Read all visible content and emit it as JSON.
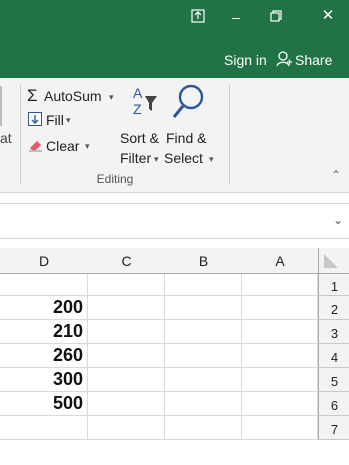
{
  "titlebar": {
    "ribbon_display_icon": "ribbon-display-options-icon",
    "minimize_glyph": "–",
    "restore_glyph": "🗗",
    "close_glyph": "✕",
    "sign_in": "Sign in",
    "share": "Share",
    "share_icon": "person-icon",
    "accent_color": "#217346"
  },
  "ribbon": {
    "cut_fragment": "at",
    "autosum": "AutoSum",
    "fill": "Fill",
    "clear": "Clear",
    "sort_filter_line1": "Sort &",
    "sort_filter_line2": "Filter",
    "find_select_line1": "Find &",
    "find_select_line2": "Select",
    "group_label": "Editing"
  },
  "grid": {
    "columns": [
      "D",
      "C",
      "B",
      "A"
    ],
    "rows": [
      "1",
      "2",
      "3",
      "4",
      "5",
      "6",
      "7"
    ],
    "values": [
      "",
      "200",
      "210",
      "260",
      "300",
      "500",
      ""
    ]
  }
}
